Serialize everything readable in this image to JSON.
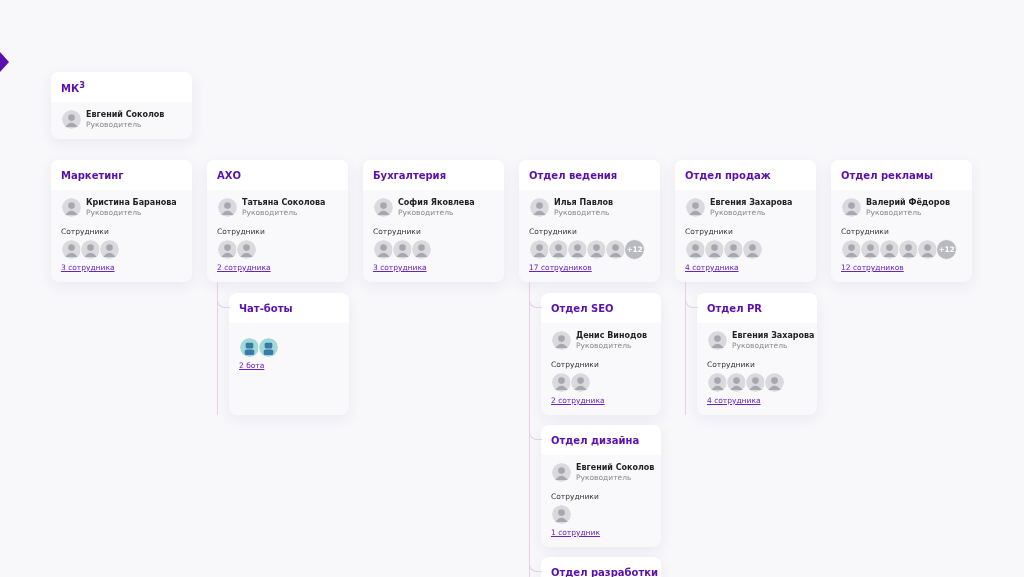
{
  "top": {
    "title": "МК$^{3}$",
    "head": {
      "name": "Евгений Соколов",
      "role": "Руководитель"
    }
  },
  "departments": [
    {
      "title": "Маркетинг",
      "head": {
        "name": "Кристина Баранова",
        "role": "Руководитель"
      },
      "staff_label": "Сотрудники",
      "avatars": [
        {
          "kind": "person"
        },
        {
          "kind": "person"
        },
        {
          "kind": "person"
        }
      ],
      "link": "3 сотрудника"
    },
    {
      "title": "АХО",
      "head": {
        "name": "Татьяна Соколова",
        "role": "Руководитель"
      },
      "staff_label": "Сотрудники",
      "avatars": [
        {
          "kind": "person"
        },
        {
          "kind": "person"
        }
      ],
      "link": "2 сотрудника",
      "children": [
        {
          "title": "Чат-боты",
          "avatars": [
            {
              "kind": "bot"
            },
            {
              "kind": "bot"
            }
          ],
          "link": "2 бота"
        }
      ]
    },
    {
      "title": "Бухгалтерия",
      "head": {
        "name": "София Яковлева",
        "role": "Руководитель"
      },
      "staff_label": "Сотрудники",
      "avatars": [
        {
          "kind": "person"
        },
        {
          "kind": "person"
        },
        {
          "kind": "person"
        }
      ],
      "link": "3 сотрудника"
    },
    {
      "title": "Отдел ведения",
      "head": {
        "name": "Илья Павлов",
        "role": "Руководитель"
      },
      "staff_label": "Сотрудники",
      "avatars": [
        {
          "kind": "person"
        },
        {
          "kind": "person"
        },
        {
          "kind": "person"
        },
        {
          "kind": "person"
        },
        {
          "kind": "person"
        }
      ],
      "more": "+12",
      "link": "17 сотрудников",
      "children": [
        {
          "title": "Отдел SEO",
          "head": {
            "name": "Денис Винодов",
            "role": "Руководитель"
          },
          "staff_label": "Сотрудники",
          "avatars": [
            {
              "kind": "person"
            },
            {
              "kind": "person"
            }
          ],
          "link": "2 сотрудника"
        },
        {
          "title": "Отдел дизайна",
          "head": {
            "name": "Евгений Соколов",
            "role": "Руководитель"
          },
          "staff_label": "Сотрудники",
          "avatars": [
            {
              "kind": "person"
            }
          ],
          "link": "1 сотрудник"
        },
        {
          "title": "Отдел разработки"
        }
      ]
    },
    {
      "title": "Отдел продаж",
      "head": {
        "name": "Евгения Захарова",
        "role": "Руководитель"
      },
      "staff_label": "Сотрудники",
      "avatars": [
        {
          "kind": "person"
        },
        {
          "kind": "person"
        },
        {
          "kind": "person"
        },
        {
          "kind": "person"
        }
      ],
      "link": "4 сотрудника",
      "children": [
        {
          "title": "Отдел PR",
          "head": {
            "name": "Евгения Захарова",
            "role": "Руководитель"
          },
          "staff_label": "Сотрудники",
          "avatars": [
            {
              "kind": "person"
            },
            {
              "kind": "person"
            },
            {
              "kind": "person"
            },
            {
              "kind": "person"
            }
          ],
          "link": "4 сотрудника"
        }
      ]
    },
    {
      "title": "Отдел рекламы",
      "head": {
        "name": "Валерий Фёдоров",
        "role": "Руководитель"
      },
      "staff_label": "Сотрудники",
      "avatars": [
        {
          "kind": "person"
        },
        {
          "kind": "person"
        },
        {
          "kind": "person"
        },
        {
          "kind": "person"
        },
        {
          "kind": "person"
        }
      ],
      "more": "+12",
      "link": "12 сотрудников"
    }
  ]
}
